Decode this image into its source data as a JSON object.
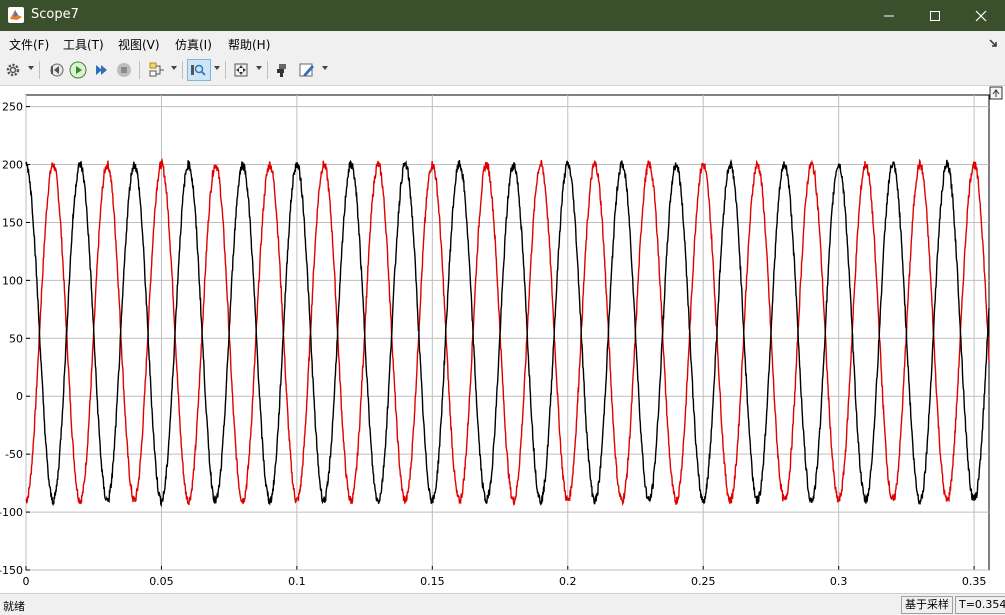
{
  "window": {
    "title": "Scope7"
  },
  "menu": [
    {
      "label": "文件(F)"
    },
    {
      "label": "工具(T)"
    },
    {
      "label": "视图(V)"
    },
    {
      "label": "仿真(I)"
    },
    {
      "label": "帮助(H)"
    }
  ],
  "toolbar_icons": [
    "gear-icon",
    "step-back-icon",
    "run-icon",
    "step-forward-icon",
    "stop-icon",
    "signal-trigger-icon",
    "zoom-icon",
    "fit-view-icon",
    "style-icon",
    "edit-icon"
  ],
  "status": {
    "text": "就绪",
    "mode": "基于采样",
    "time": "T=0.354"
  },
  "chart_data": {
    "type": "line",
    "title": "",
    "xlabel": "",
    "ylabel": "",
    "xlim": [
      0,
      0.3555
    ],
    "ylim": [
      -150,
      260
    ],
    "xticks": [
      0,
      0.05,
      0.1,
      0.15,
      0.2,
      0.25,
      0.3,
      0.35
    ],
    "yticks": [
      -150,
      -100,
      -50,
      0,
      50,
      100,
      150,
      200,
      250
    ],
    "xtick_labels": [
      "0",
      "0.05",
      "0.1",
      "0.15",
      "0.2",
      "0.25",
      "0.3",
      "0.35"
    ],
    "ytick_labels": [
      "-150",
      "-100",
      "-50",
      "0",
      "50",
      "100",
      "150",
      "200",
      "250"
    ],
    "grid": true,
    "colors": {
      "series1": "#e00000",
      "series2": "#000000",
      "background": "#ffffff",
      "grid": "#bfbfbf"
    },
    "series": [
      {
        "color": "#e00000",
        "frequency_hz": 50,
        "offset": 55,
        "amplitude": 145,
        "phase_deg": 0,
        "start_offset": 0,
        "x": [
          0,
          0.005,
          0.01,
          0.015,
          0.02,
          0.025,
          0.03,
          0.035,
          0.04
        ],
        "y": [
          0,
          170,
          -70,
          -80,
          120,
          215,
          -70,
          -80,
          195
        ]
      },
      {
        "color": "#000000",
        "frequency_hz": 50,
        "offset": 55,
        "amplitude": 145,
        "phase_deg": 180,
        "start_offset": 10,
        "x": [
          0,
          0.004,
          0.01,
          0.015,
          0.02,
          0.025,
          0.03,
          0.035,
          0.04
        ],
        "y": [
          10,
          -105,
          210,
          200,
          -80,
          -80,
          200,
          195,
          -90
        ]
      }
    ]
  }
}
